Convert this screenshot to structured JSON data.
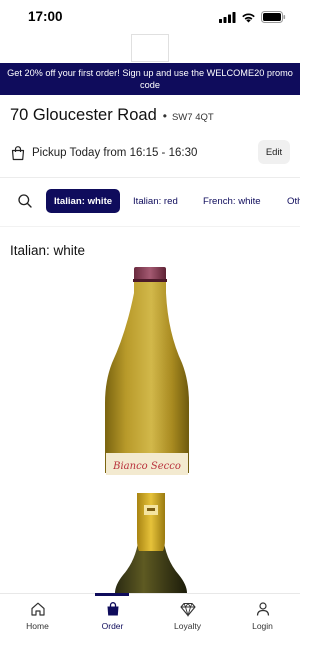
{
  "status_bar": {
    "time": "17:00"
  },
  "promo_banner": {
    "text": "Get 20% off your first order! Sign up and use the WELCOME20 promo code"
  },
  "store": {
    "name": "70 Gloucester Road",
    "separator": "•",
    "postcode": "SW7 4QT"
  },
  "pickup": {
    "text": "Pickup Today from 16:15 - 16:30",
    "edit_label": "Edit"
  },
  "tabs": [
    {
      "label": "Italian: white",
      "active": true
    },
    {
      "label": "Italian: red",
      "active": false
    },
    {
      "label": "French: white",
      "active": false
    },
    {
      "label": "Oth",
      "active": false
    }
  ],
  "section": {
    "title": "Italian: white"
  },
  "product": {
    "bottle_label": "Bianco Secco"
  },
  "bottom_nav": [
    {
      "label": "Home",
      "icon": "home-icon"
    },
    {
      "label": "Order",
      "icon": "shopping-bag-icon",
      "active": true
    },
    {
      "label": "Loyalty",
      "icon": "diamond-icon"
    },
    {
      "label": "Login",
      "icon": "person-icon"
    }
  ],
  "colors": {
    "brand": "#0f0c5c",
    "background": "#ffffff"
  }
}
